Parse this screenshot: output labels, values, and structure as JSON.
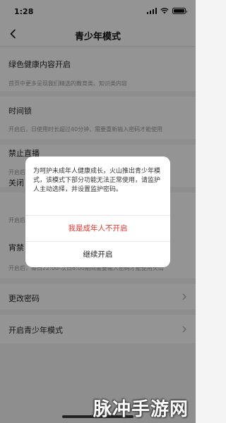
{
  "status_bar": {
    "time": "1:28"
  },
  "nav": {
    "title": "青少年模式"
  },
  "settings": {
    "green_content": {
      "title": "绿色健康内容开启",
      "desc": "首页中更多呈现我们精选的教育类、知识类内容"
    },
    "time_lock": {
      "title": "时间锁",
      "desc": "开启后，日使用时长超过40分钟，需要重新输入密码才能使用"
    },
    "disable_live": {
      "title": "禁止直播",
      "desc": "开启后，"
    },
    "close_item": {
      "title": "关闭",
      "desc": "开启后，"
    },
    "night_ban": {
      "title": "宵禁",
      "desc": "开启后，每日22:00-次日6:00期间需要输入密码才能使用火山"
    },
    "change_password": {
      "title": "更改密码"
    },
    "enable_teen_mode": {
      "title": "开启青少年模式"
    }
  },
  "dialog": {
    "message": "为呵护未成年人健康成长，火山推出青少年模式，该模式下部分功能无法正常使用，请监护人主动选择，并设置监护密码。",
    "refuse_label": "我是成年人不开启",
    "continue_label": "继续开启"
  },
  "watermark": "脉冲手游网",
  "colors": {
    "accent_red": "#e8362c",
    "overlay": "rgba(0,0,0,0.42)"
  }
}
